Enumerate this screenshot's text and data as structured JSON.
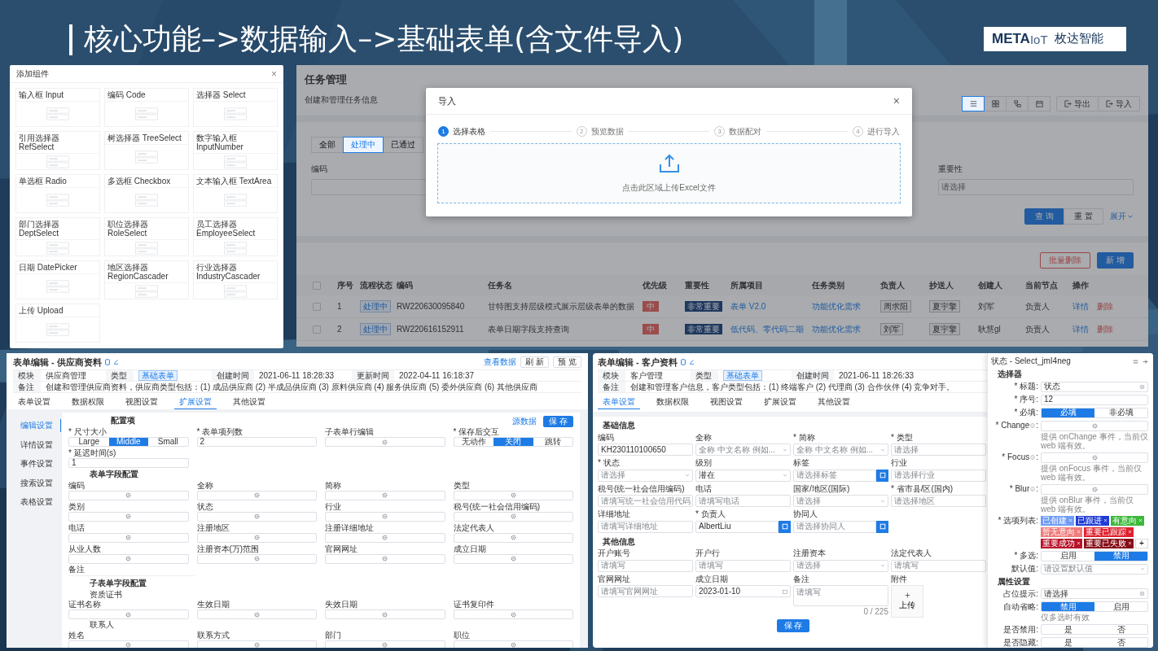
{
  "slide": {
    "title": "核心功能–>数据输入–>基础表单(含文件导入)",
    "logo": {
      "brand": "META",
      "suffix": "IoT",
      "company": "枚达智能"
    }
  },
  "add_component_dialog": {
    "title": "添加组件",
    "close": "×",
    "components": [
      {
        "label": "输入框 Input"
      },
      {
        "label": "编码 Code"
      },
      {
        "label": "选择器 Select"
      },
      {
        "label": "引用选择器 RefSelect"
      },
      {
        "label": "树选择器 TreeSelect"
      },
      {
        "label": "数字输入框 InputNumber"
      },
      {
        "label": "单选框 Radio"
      },
      {
        "label": "多选框 Checkbox"
      },
      {
        "label": "文本输入框 TextArea"
      },
      {
        "label": "部门选择器 DeptSelect"
      },
      {
        "label": "职位选择器 RoleSelect"
      },
      {
        "label": "员工选择器 EmployeeSelect"
      },
      {
        "label": "日期 DatePicker"
      },
      {
        "label": "地区选择器 RegionCascader"
      },
      {
        "label": "行业选择器 IndustryCascader"
      },
      {
        "label": "上传 Upload"
      }
    ]
  },
  "task_page": {
    "title": "任务管理",
    "subtitle": "创建和管理任务信息",
    "view_buttons": [
      {
        "kind": "list",
        "selected": true
      },
      {
        "kind": "grid",
        "selected": false
      },
      {
        "kind": "tree",
        "selected": false
      },
      {
        "kind": "calendar",
        "selected": false
      }
    ],
    "actions": [
      "导出",
      "导入"
    ],
    "status_tabs": [
      {
        "label": "全部",
        "selected": false
      },
      {
        "label": "处理中",
        "selected": true
      },
      {
        "label": "已通过",
        "selected": false
      }
    ],
    "filters": [
      {
        "label": "编码"
      },
      {
        "label": "重要性",
        "placeholder": "请选择"
      }
    ],
    "search_buttons": [
      "查 询",
      "重 置"
    ],
    "expand": "展开",
    "table_actions": [
      "批量删除",
      "新 增"
    ],
    "select_all_checked": false,
    "columns": [
      "序号",
      "流程状态",
      "编码",
      "任务名",
      "优先级",
      "重要性",
      "所属项目",
      "任务类别",
      "负责人",
      "抄送人",
      "创建人",
      "当前节点",
      "操作"
    ],
    "rows": [
      {
        "checked": false,
        "index": "1",
        "status": "处理中",
        "code": "RW220630095840",
        "name": "甘特图支持层级模式展示层级表单的数据",
        "priority": "中",
        "importance": "非常重要",
        "project": "表单 V2.0",
        "category": "功能优化需求",
        "owner": "周求阳",
        "cc": "夏宇擎",
        "creator": "刘军",
        "node": "负责人",
        "actions": [
          "详情",
          "删除"
        ]
      },
      {
        "checked": false,
        "index": "2",
        "status": "处理中",
        "code": "RW220616152911",
        "name": "表单日期字段支持查询",
        "priority": "中",
        "importance": "非常重要",
        "project": "低代码、零代码二期",
        "category": "功能优化需求",
        "owner": "刘军",
        "cc": "夏宇擎",
        "creator": "耿慧gl",
        "node": "负责人",
        "actions": [
          "详情",
          "删除"
        ]
      }
    ]
  },
  "import_dialog": {
    "title": "导入",
    "close": "×",
    "steps": [
      {
        "number": "1",
        "label": "选择表格",
        "selected": true
      },
      {
        "number": "2",
        "label": "预览数据",
        "selected": false
      },
      {
        "number": "3",
        "label": "数据配对",
        "selected": false
      },
      {
        "number": "4",
        "label": "进行导入",
        "selected": false
      }
    ],
    "upload_hint": "点击此区域上传Excel文件"
  },
  "supplier_form": {
    "title": "表单编辑 - 供应商资料",
    "header_actions": [
      {
        "kind": "link",
        "label": "查看数据"
      },
      {
        "kind": "button",
        "label": "刷 新"
      },
      {
        "kind": "button",
        "label": "预 览"
      }
    ],
    "info": [
      {
        "label": "模块",
        "value": "供应商管理"
      },
      {
        "label": "类型",
        "value": "基础表单",
        "kind": "tag"
      },
      {
        "label": "创建时间",
        "value": "2021-06-11 18:28:33"
      },
      {
        "label": "更新时间",
        "value": "2022-04-11 16:18:37"
      }
    ],
    "note": {
      "label": "备注",
      "value": "创建和管理供应商资料，供应商类型包括：(1) 成品供应商 (2) 半成品供应商 (3) 原料供应商 (4) 服务供应商 (5) 委外供应商 (6) 其他供应商"
    },
    "tabs": [
      {
        "label": "表单设置",
        "selected": false
      },
      {
        "label": "数据权限",
        "selected": false
      },
      {
        "label": "视图设置",
        "selected": false
      },
      {
        "label": "扩展设置",
        "selected": true
      },
      {
        "label": "其他设置",
        "selected": false
      }
    ],
    "side_menu": [
      {
        "label": "编辑设置",
        "selected": true
      },
      {
        "label": "详情设置",
        "selected": false
      },
      {
        "label": "事件设置",
        "selected": false
      },
      {
        "label": "搜索设置",
        "selected": false
      },
      {
        "label": "表格设置",
        "selected": false
      }
    ],
    "toolbar": {
      "link": "源数据",
      "save": "保 存"
    },
    "config_title": "配置项",
    "settings": [
      {
        "label": "* 尺寸大小",
        "kind": "segmented",
        "options": [
          {
            "label": "Large",
            "selected": false
          },
          {
            "label": "Middle",
            "selected": true
          },
          {
            "label": "Small",
            "selected": false
          }
        ]
      },
      {
        "label": "* 表单项列数",
        "kind": "input",
        "value": "2"
      },
      {
        "label": "子表单行编辑",
        "kind": "gear"
      },
      {
        "label": "* 保存后交互",
        "kind": "segmented",
        "options": [
          {
            "label": "无动作",
            "selected": false
          },
          {
            "label": "关闭",
            "selected": true
          },
          {
            "label": "跳转",
            "selected": false
          }
        ]
      },
      {
        "label": "* 延迟时间(s)",
        "kind": "input",
        "value": "1"
      }
    ],
    "field_title": "表单字段配置",
    "fields": [
      "编码",
      "全称",
      "简称",
      "类型",
      "类别",
      "状态",
      "行业",
      "税号(统一社会信用编码)",
      "电话",
      "注册地区",
      "注册详细地址",
      "法定代表人",
      "从业人数",
      "注册资本(万)范围",
      "官网网址",
      "成立日期"
    ],
    "note_field": "备注",
    "subform_title": "子表单字段配置",
    "subforms": [
      {
        "name": "资质证书",
        "fields": [
          "证书名称",
          "生效日期",
          "失效日期",
          "证书复印件"
        ]
      },
      {
        "name": "联系人",
        "fields": [
          "姓名",
          "联系方式",
          "部门",
          "职位"
        ]
      }
    ]
  },
  "customer_form": {
    "title": "表单编辑 - 客户资料",
    "info": [
      {
        "label": "模块",
        "value": "客户管理"
      },
      {
        "label": "类型",
        "value": "基础表单",
        "kind": "tag"
      },
      {
        "label": "创建时间",
        "value": "2021-06-11 18:26:33"
      }
    ],
    "note": {
      "label": "备注",
      "value": "创建和管理客户信息，客户类型包括：(1) 终端客户 (2) 代理商 (3) 合作伙伴 (4) 竞争对手。"
    },
    "tabs": [
      {
        "label": "表单设置",
        "selected": true
      },
      {
        "label": "数据权限",
        "selected": false
      },
      {
        "label": "视图设置",
        "selected": false
      },
      {
        "label": "扩展设置",
        "selected": false
      },
      {
        "label": "其他设置",
        "selected": false
      }
    ],
    "sections": [
      {
        "title": "基础信息",
        "fields": [
          {
            "label": "编码",
            "kind": "input",
            "value": "KH230110100650"
          },
          {
            "label": "全称",
            "kind": "select",
            "placeholder": "全称 中文名称 例如..."
          },
          {
            "label": "* 简称",
            "kind": "select",
            "placeholder": "全称 中文名称 例如..."
          },
          {
            "label": "* 类型",
            "kind": "input",
            "placeholder": "请选择"
          },
          {
            "label": "* 状态",
            "kind": "select",
            "placeholder": "请选择"
          },
          {
            "label": "级别",
            "kind": "select",
            "value": "潜在"
          },
          {
            "label": "标签",
            "kind": "picker",
            "placeholder": "请选择标签"
          },
          {
            "label": "行业",
            "kind": "input",
            "placeholder": "请选择行业"
          },
          {
            "label": "税号(统一社会信用编码)",
            "kind": "input",
            "placeholder": "请填写统一社会信用代码"
          },
          {
            "label": "电话",
            "kind": "input",
            "placeholder": "请填写电话"
          },
          {
            "label": "国家/地区(国际)",
            "kind": "select",
            "placeholder": "请选择"
          },
          {
            "label": "* 省市县/区(国内)",
            "kind": "input",
            "placeholder": "请选择地区"
          },
          {
            "label": "详细地址",
            "kind": "input",
            "placeholder": "请填写详细地址"
          },
          {
            "label": "* 负责人",
            "kind": "picker",
            "value": "AlbertLiu"
          },
          {
            "label": "协同人",
            "kind": "picker",
            "placeholder": "请选择协同人"
          }
        ]
      },
      {
        "title": "其他信息",
        "fields": [
          {
            "label": "开户账号",
            "kind": "input",
            "placeholder": "请填写"
          },
          {
            "label": "开户行",
            "kind": "input",
            "placeholder": "请填写"
          },
          {
            "label": "注册资本",
            "kind": "select",
            "placeholder": "请选择"
          },
          {
            "label": "法定代表人",
            "kind": "input",
            "placeholder": "请填写"
          },
          {
            "label": "官网网址",
            "kind": "input",
            "placeholder": "请填写官网网址"
          },
          {
            "label": "成立日期",
            "kind": "date",
            "value": "2023-01-10"
          },
          {
            "label": "备注",
            "kind": "textarea",
            "placeholder": "请填写",
            "counter": "0 / 225"
          },
          {
            "label": "附件",
            "kind": "upload",
            "button": "上传"
          }
        ]
      }
    ],
    "save": "保 存"
  },
  "property_drawer": {
    "title": "状态 - Select_jmI4neg",
    "sections": [
      {
        "title": "选择器",
        "rows": [
          {
            "label": "* 标题:",
            "kind": "input",
            "value": "状态",
            "clearable": true
          },
          {
            "label": "* 序号:",
            "kind": "input",
            "value": "12",
            "clearable": false
          },
          {
            "label": "* 必填:",
            "kind": "segmented",
            "options": [
              {
                "label": "必填",
                "selected": true
              },
              {
                "label": "非必填",
                "selected": false
              }
            ]
          },
          {
            "label": "* Change",
            "colon": ":",
            "kind": "gear",
            "hint": "提供 onChange 事件，当前仅 web 端有效。"
          },
          {
            "label": "* Focus",
            "colon": ":",
            "kind": "gear",
            "hint": "提供 onFocus 事件，当前仅 web 端有效。"
          },
          {
            "label": "* Blur",
            "colon": ":",
            "kind": "gear",
            "hint": "提供 onBlur 事件，当前仅 web 端有效。"
          },
          {
            "label": "* 选项列表:",
            "kind": "tags",
            "add": "+",
            "tags": [
              {
                "label": "已创建",
                "color": "#6f9cf5"
              },
              {
                "label": "已跟进",
                "color": "#1f3cd6"
              },
              {
                "label": "有意向",
                "color": "#3cb83a"
              },
              {
                "label": "暂无意向",
                "color": "#f07c7c"
              },
              {
                "label": "重要已跟踪",
                "color": "#e0202e"
              },
              {
                "label": "重要成功",
                "color": "#b8142a"
              },
              {
                "label": "重要已失败",
                "color": "#860e18"
              }
            ]
          },
          {
            "label": "* 多选:",
            "kind": "segmented",
            "options": [
              {
                "label": "启用",
                "selected": false
              },
              {
                "label": "禁用",
                "selected": true
              }
            ]
          },
          {
            "label": "默认值:",
            "kind": "select",
            "placeholder": "请设置默认值"
          }
        ]
      },
      {
        "title": "属性设置",
        "rows": [
          {
            "label": "占位提示:",
            "kind": "input",
            "value": "请选择",
            "clearable": true
          },
          {
            "label": "自动省略:",
            "kind": "segmented",
            "options": [
              {
                "label": "禁用",
                "selected": true
              },
              {
                "label": "启用",
                "selected": false
              }
            ],
            "hint": "仅多选时有效"
          },
          {
            "label": "是否禁用:",
            "kind": "segmented",
            "options": [
              {
                "label": "是",
                "selected": false
              },
              {
                "label": "否",
                "selected": false
              }
            ]
          },
          {
            "label": "是否隐藏:",
            "kind": "segmented",
            "options": [
              {
                "label": "是",
                "selected": false
              },
              {
                "label": "否",
                "selected": false
              }
            ]
          }
        ]
      }
    ]
  }
}
